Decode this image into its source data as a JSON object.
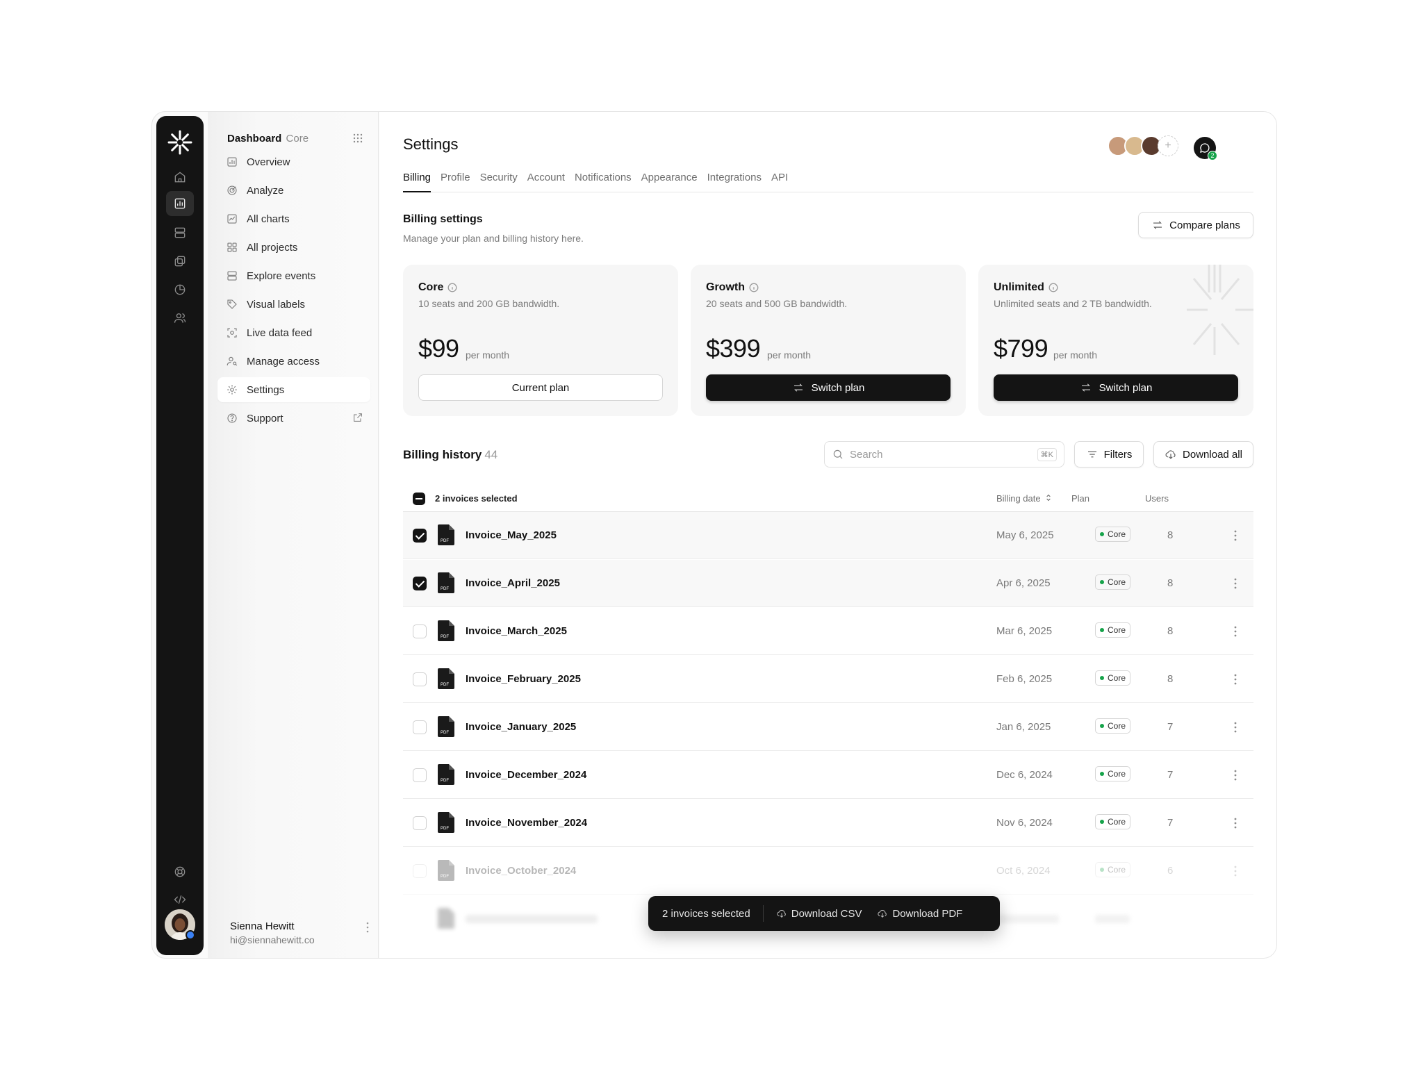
{
  "brand": {
    "name": "Dashboard",
    "sub": "Core"
  },
  "nav": {
    "items": [
      {
        "label": "Overview",
        "icon": "bar-chart-icon"
      },
      {
        "label": "Analyze",
        "icon": "target-icon"
      },
      {
        "label": "All charts",
        "icon": "line-chart-icon"
      },
      {
        "label": "All projects",
        "icon": "grid-icon"
      },
      {
        "label": "Explore events",
        "icon": "layers-icon"
      },
      {
        "label": "Visual labels",
        "icon": "tag-icon"
      },
      {
        "label": "Live data feed",
        "icon": "focus-icon"
      },
      {
        "label": "Manage access",
        "icon": "user-key-icon"
      },
      {
        "label": "Settings",
        "icon": "gear-icon",
        "active": true
      },
      {
        "label": "Support",
        "icon": "help-icon"
      }
    ]
  },
  "user": {
    "name": "Sienna Hewitt",
    "email": "hi@siennahewitt.co"
  },
  "page": {
    "title": "Settings"
  },
  "tabs": [
    "Billing",
    "Profile",
    "Security",
    "Account",
    "Notifications",
    "Appearance",
    "Integrations",
    "API"
  ],
  "header": {
    "chat_count": "2",
    "add_label": "+"
  },
  "billing": {
    "title": "Billing settings",
    "subtitle": "Manage your plan and billing history here.",
    "compare_label": "Compare plans"
  },
  "plans": [
    {
      "name": "Core",
      "desc": "10 seats and 200 GB bandwidth.",
      "price": "$99",
      "per": "per month",
      "button": "Current plan",
      "style": "light"
    },
    {
      "name": "Growth",
      "desc": "20 seats and 500 GB bandwidth.",
      "price": "$399",
      "per": "per month",
      "button": "Switch plan",
      "style": "dark"
    },
    {
      "name": "Unlimited",
      "desc": "Unlimited seats and 2 TB bandwidth.",
      "price": "$799",
      "per": "per month",
      "button": "Switch plan",
      "style": "dark"
    }
  ],
  "history": {
    "title": "Billing history",
    "count": "44",
    "search_placeholder": "Search",
    "search_shortcut": "⌘K",
    "filters_label": "Filters",
    "download_all_label": "Download all",
    "selected_label": "2 invoices selected",
    "columns": {
      "date": "Billing date",
      "plan": "Plan",
      "users": "Users"
    },
    "rows": [
      {
        "name": "Invoice_May_2025",
        "date": "May 6, 2025",
        "plan": "Core",
        "users": "8",
        "checked": true
      },
      {
        "name": "Invoice_April_2025",
        "date": "Apr 6, 2025",
        "plan": "Core",
        "users": "8",
        "checked": true
      },
      {
        "name": "Invoice_March_2025",
        "date": "Mar 6, 2025",
        "plan": "Core",
        "users": "8",
        "checked": false
      },
      {
        "name": "Invoice_February_2025",
        "date": "Feb 6, 2025",
        "plan": "Core",
        "users": "8",
        "checked": false
      },
      {
        "name": "Invoice_January_2025",
        "date": "Jan 6, 2025",
        "plan": "Core",
        "users": "7",
        "checked": false
      },
      {
        "name": "Invoice_December_2024",
        "date": "Dec 6, 2024",
        "plan": "Core",
        "users": "7",
        "checked": false
      },
      {
        "name": "Invoice_November_2024",
        "date": "Nov 6, 2024",
        "plan": "Core",
        "users": "7",
        "checked": false
      },
      {
        "name": "Invoice_October_2024",
        "date": "Oct 6, 2024",
        "plan": "Core",
        "users": "6",
        "checked": false
      }
    ]
  },
  "toast": {
    "label": "2 invoices selected",
    "csv_label": "Download CSV",
    "pdf_label": "Download PDF"
  },
  "colors": {
    "accent": "#141414",
    "status_green": "#16a34a"
  }
}
